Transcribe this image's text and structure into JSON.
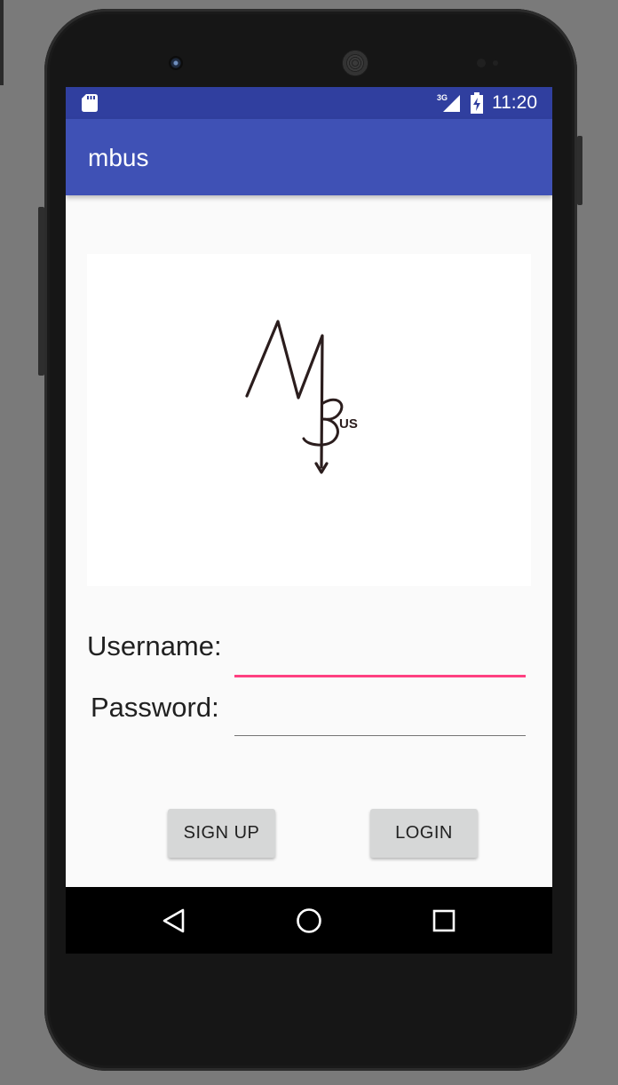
{
  "status_bar": {
    "network_type": "3G",
    "time": "11:20",
    "background_color": "#303f9f",
    "icons": [
      "sd-card-icon",
      "signal-icon",
      "battery-charging-icon"
    ]
  },
  "app_bar": {
    "title": "mbus",
    "background_color": "#3f51b5"
  },
  "logo": {
    "text": "US",
    "icon": "mbus-logo"
  },
  "form": {
    "username_label": "Username:",
    "username_value": "",
    "password_label": "Password:",
    "password_value": "",
    "focused_field": "username",
    "accent_color": "#ff4081"
  },
  "buttons": {
    "signup_label": "SIGN UP",
    "login_label": "LOGIN"
  },
  "navigation_bar": {
    "icons": [
      "back-icon",
      "home-icon",
      "recents-icon"
    ]
  }
}
